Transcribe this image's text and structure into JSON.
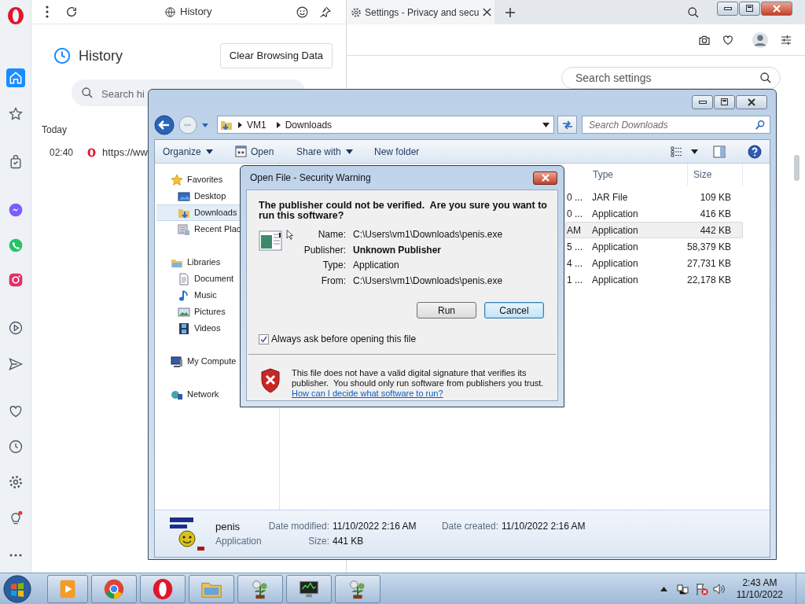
{
  "browser": {
    "sidebar": [
      {
        "selected": true
      },
      {
        "selected": false
      },
      {
        "selected": false
      },
      {
        "selected": false
      },
      {
        "selected": false
      },
      {
        "selected": false
      },
      {
        "selected": false
      },
      {
        "selected": false
      },
      {
        "selected": false
      },
      {
        "selected": false
      },
      {
        "selected": false
      },
      {
        "selected": false
      }
    ],
    "history_panel": {
      "bar_title": "History",
      "title": "History",
      "clear_button": "Clear Browsing Data",
      "search_placeholder": "Search hi",
      "section": "Today",
      "entries": [
        {
          "time": "02:40",
          "url": "https://ww"
        }
      ]
    },
    "tab": {
      "title": "Settings - Privacy and secu"
    },
    "settings_search": {
      "placeholder": "Search settings"
    }
  },
  "explorer": {
    "breadcrumb": [
      "VM1",
      "Downloads"
    ],
    "search_placeholder": "Search Downloads",
    "toolbar": [
      {
        "label": "Organize",
        "dropdown": true
      },
      {
        "label": "Open",
        "dropdown": false
      },
      {
        "label": "Share with",
        "dropdown": true
      },
      {
        "label": "New folder",
        "dropdown": false
      }
    ],
    "nav": [
      {
        "label": "Favorites",
        "selected": false,
        "children": [
          {
            "label": "Desktop",
            "selected": false
          },
          {
            "label": "Downloads",
            "selected": true
          },
          {
            "label": "Recent Plac",
            "selected": false
          }
        ]
      },
      {
        "label": "Libraries",
        "selected": false,
        "children": [
          {
            "label": "Document",
            "selected": false
          },
          {
            "label": "Music",
            "selected": false
          },
          {
            "label": "Pictures",
            "selected": false
          },
          {
            "label": "Videos",
            "selected": false
          }
        ]
      },
      {
        "label": "My Compute",
        "selected": false
      },
      {
        "label": "Network",
        "selected": false
      }
    ],
    "columns": [
      "Type",
      "Size"
    ],
    "rows": [
      {
        "column_1": "0 ...",
        "type": "JAR File",
        "size": "109 KB",
        "selected": false
      },
      {
        "column_1": "0 ...",
        "type": "Application",
        "size": "416 KB",
        "selected": false
      },
      {
        "column_1": "AM",
        "type": "Application",
        "size": "442 KB",
        "selected": true
      },
      {
        "column_1": "5 ...",
        "type": "Application",
        "size": "58,379 KB",
        "selected": false
      },
      {
        "column_1": "4 ...",
        "type": "Application",
        "size": "27,731 KB",
        "selected": false
      },
      {
        "column_1": "1 ...",
        "type": "Application",
        "size": "22,178 KB",
        "selected": false
      }
    ],
    "details": {
      "name": "penis",
      "type": "Application",
      "date_modified_label": "Date modified:",
      "date_modified": "11/10/2022 2:16 AM",
      "date_created_label": "Date created:",
      "date_created": "11/10/2022 2:16 AM",
      "size_label": "Size:",
      "size": "441 KB"
    }
  },
  "dialog": {
    "title": "Open File - Security Warning",
    "heading": "The publisher could not be verified.  Are you sure you want to run this software?",
    "fields": [
      {
        "label": "Name:",
        "value": "C:\\Users\\vm1\\Downloads\\penis.exe",
        "bold": false
      },
      {
        "label": "Publisher:",
        "value": "Unknown Publisher",
        "bold": true
      },
      {
        "label": "Type:",
        "value": "Application",
        "bold": false
      },
      {
        "label": "From:",
        "value": "C:\\Users\\vm1\\Downloads\\penis.exe",
        "bold": false
      }
    ],
    "buttons": [
      {
        "label": "Run",
        "default": false
      },
      {
        "label": "Cancel",
        "default": true
      }
    ],
    "checkbox": {
      "label": "Always ask before opening this file",
      "checked": true
    },
    "warning": "This file does not have a valid digital signature that verifies its publisher.  You should only run software from publishers you trust.",
    "link": "How can I decide what software to run?"
  },
  "taskbar": {
    "time": "2:43 AM",
    "date": "11/10/2022"
  }
}
